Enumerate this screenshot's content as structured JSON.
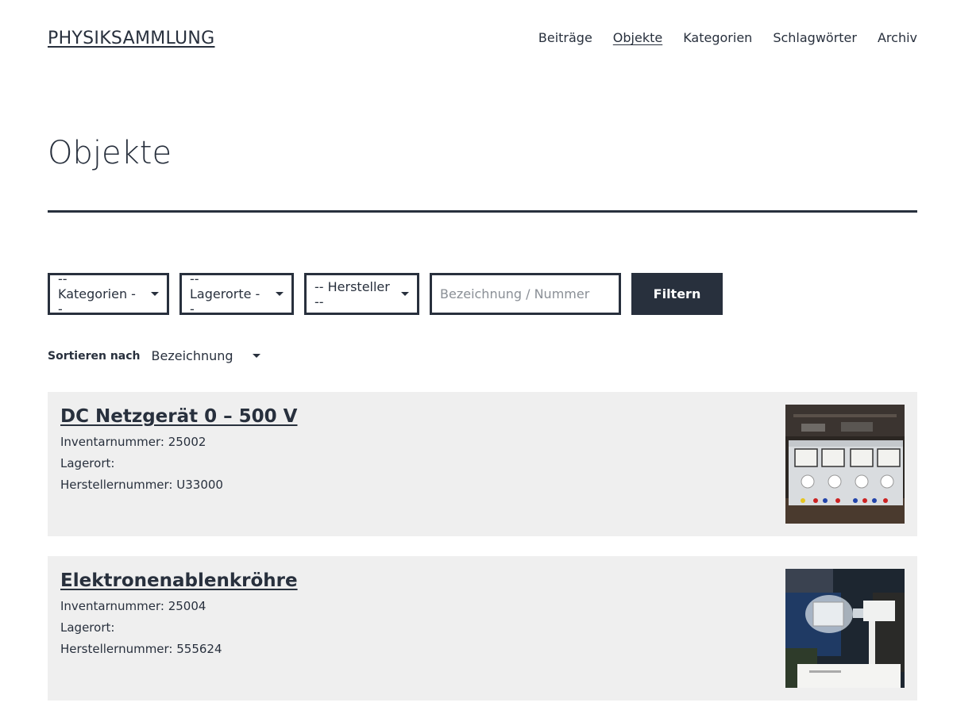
{
  "header": {
    "site_title": "PHYSIKSAMMLUNG",
    "nav": [
      {
        "label": "Beiträge"
      },
      {
        "label": "Objekte"
      },
      {
        "label": "Kategorien"
      },
      {
        "label": "Schlagwörter"
      },
      {
        "label": "Archiv"
      }
    ],
    "current_nav": "Objekte"
  },
  "page": {
    "title": "Objekte"
  },
  "filters": {
    "kategorien": "-- Kategorien --",
    "lagerorte": "-- Lagerorte --",
    "hersteller": "-- Hersteller --",
    "search_placeholder": "Bezeichnung / Nummer",
    "search_value": "",
    "submit_label": "Filtern"
  },
  "sort": {
    "label": "Sortieren nach",
    "value": "Bezeichnung"
  },
  "items": [
    {
      "title": "DC Netzgerät 0 – 500 V",
      "inventory": "Inventarnummer: 25002",
      "location": "Lagerort:",
      "manufacturer_no": "Herstellernummer: U33000"
    },
    {
      "title": "Elektronenablenkröhre",
      "inventory": "Inventarnummer: 25004",
      "location": "Lagerort:",
      "manufacturer_no": "Herstellernummer: 555624"
    }
  ]
}
